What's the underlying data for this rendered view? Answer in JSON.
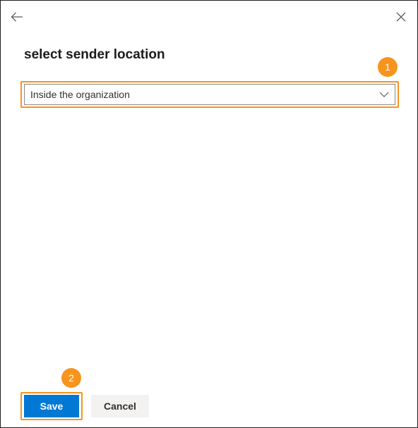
{
  "dialog": {
    "title": "select sender location"
  },
  "header": {
    "back_icon": "arrow-left-icon",
    "close_icon": "close-icon"
  },
  "sender_location_select": {
    "selected_value": "Inside the organization"
  },
  "callouts": {
    "step1": "1",
    "step2": "2",
    "color": "#f7941d"
  },
  "footer": {
    "save_label": "Save",
    "cancel_label": "Cancel"
  },
  "colors": {
    "primary": "#0078d4",
    "secondary_button": "#f3f2f1",
    "highlight": "#f7941d"
  }
}
